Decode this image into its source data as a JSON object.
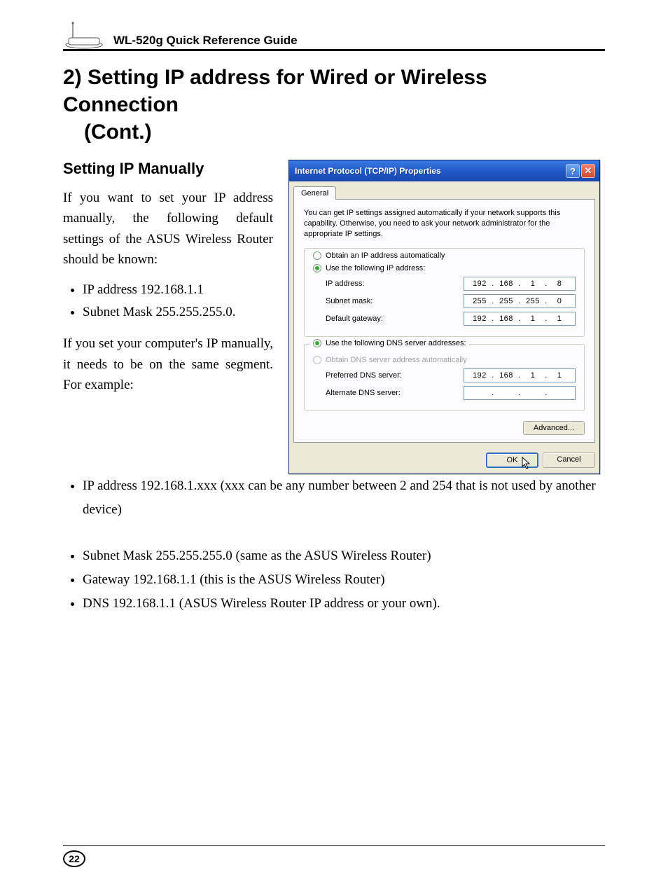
{
  "header": {
    "doc_title": "WL-520g Quick Reference Guide"
  },
  "heading": {
    "line1": "2) Setting IP address for Wired or Wireless Connection",
    "line2": "(Cont.)"
  },
  "subheading": "Setting IP Manually",
  "para1": "If you want to set your IP address manually, the following default settings of the ASUS Wireless Router should be known:",
  "list1": [
    "IP address 192.168.1.1",
    "Subnet Mask 255.255.255.0."
  ],
  "para2": "If you set your computer's IP manually, it needs to be on the same segment. For example:",
  "list2": [
    "IP address 192.168.1.xxx (xxx can be any number between 2 and 254 that is not used by another device)"
  ],
  "list3": [
    "Subnet Mask 255.255.255.0 (same as the ASUS Wireless Router)",
    "Gateway 192.168.1.1 (this is the ASUS Wireless Router)",
    "DNS 192.168.1.1 (ASUS Wireless Router IP address or your own)."
  ],
  "dialog": {
    "title": "Internet Protocol (TCP/IP) Properties",
    "tab": "General",
    "desc": "You can get IP settings assigned automatically if your network supports this capability. Otherwise, you need to ask your network administrator for the appropriate IP settings.",
    "radio_auto_ip": "Obtain an IP address automatically",
    "radio_manual_ip": "Use the following IP address:",
    "ip_label": "IP address:",
    "ip_value": [
      "192",
      "168",
      "1",
      "8"
    ],
    "subnet_label": "Subnet mask:",
    "subnet_value": [
      "255",
      "255",
      "255",
      "0"
    ],
    "gateway_label": "Default gateway:",
    "gateway_value": [
      "192",
      "168",
      "1",
      "1"
    ],
    "radio_auto_dns": "Obtain DNS server address automatically",
    "radio_manual_dns": "Use the following DNS server addresses:",
    "pref_dns_label": "Preferred DNS server:",
    "pref_dns_value": [
      "192",
      "168",
      "1",
      "1"
    ],
    "alt_dns_label": "Alternate DNS server:",
    "alt_dns_value": [
      "",
      "",
      "",
      ""
    ],
    "advanced_btn": "Advanced...",
    "ok_btn": "OK",
    "cancel_btn": "Cancel"
  },
  "page_number": "22"
}
